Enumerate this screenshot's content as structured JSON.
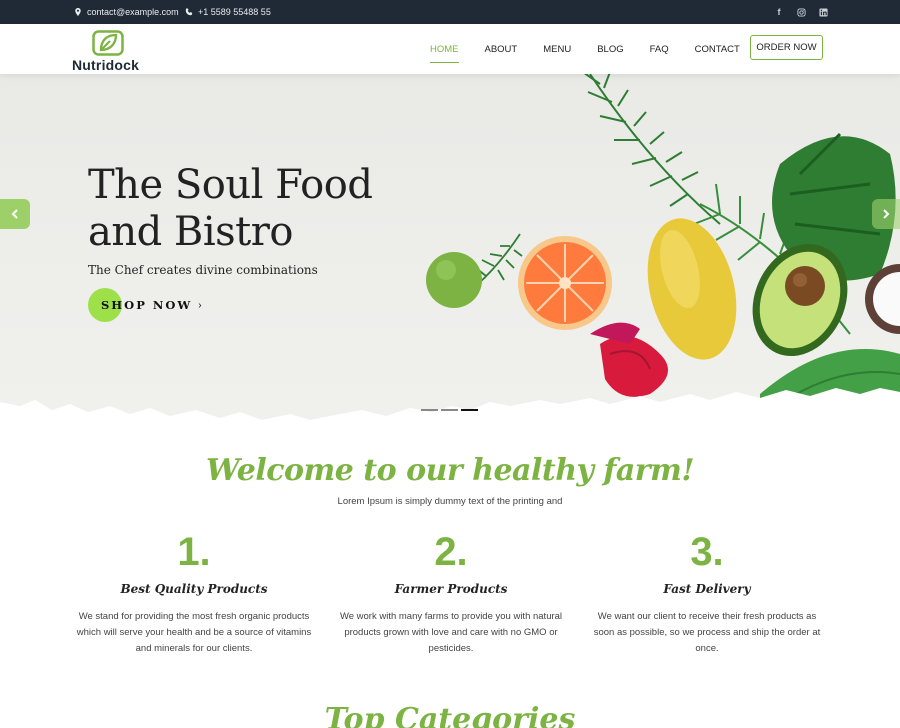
{
  "topbar": {
    "email": "contact@example.com",
    "phone": "+1 5589 55488 55",
    "social": [
      "facebook-icon",
      "instagram-icon",
      "linkedin-icon"
    ]
  },
  "header": {
    "logo_text": "Nutridock",
    "nav": [
      "HOME",
      "ABOUT",
      "MENU",
      "BLOG",
      "FAQ",
      "CONTACT"
    ],
    "active_nav": "HOME",
    "order_button": "ORDER NOW"
  },
  "hero": {
    "title_line1": "The Soul Food",
    "title_line2": "and Bistro",
    "subtitle": "The Chef creates divine combinations",
    "cta": "SHOP NOW",
    "slide_count": 3,
    "active_slide": 3
  },
  "welcome": {
    "title": "Welcome to our healthy farm!",
    "subtitle": "Lorem Ipsum is simply dummy text of the printing and"
  },
  "features": [
    {
      "number": "1.",
      "title": "Best Quality Products",
      "description": "We stand for providing the most fresh organic products which will serve your health and be a source of vitamins and minerals for our clients."
    },
    {
      "number": "2.",
      "title": "Farmer Products",
      "description": "We work with many farms to provide you with natural products grown with love and care with no GMO or pesticides."
    },
    {
      "number": "3.",
      "title": "Fast Delivery",
      "description": "We want our client to receive their fresh products as soon as possible, so we process and ship the order at once."
    }
  ],
  "categories": {
    "title": "Top Categories"
  },
  "colors": {
    "accent": "#7cb342",
    "topbar": "#1f2a36",
    "cta_blob": "#9ee04a"
  }
}
